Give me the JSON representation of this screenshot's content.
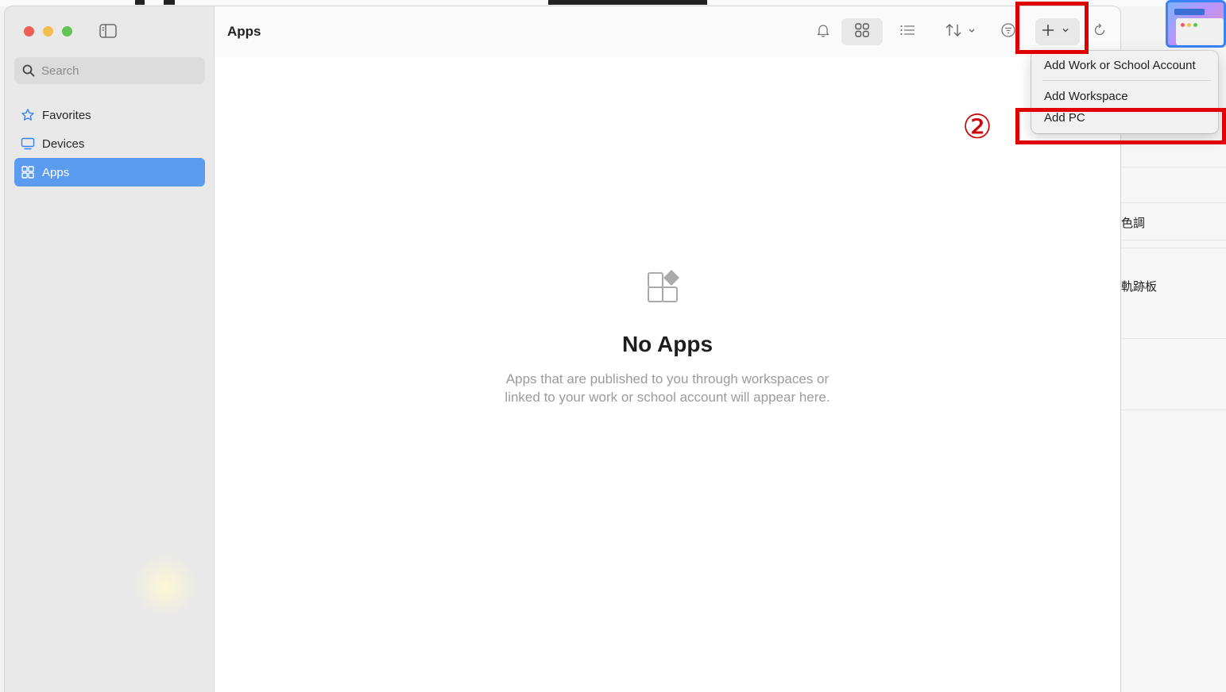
{
  "window": {
    "title": "Apps"
  },
  "search": {
    "placeholder": "Search"
  },
  "sidebar": {
    "items": [
      {
        "label": "Favorites",
        "icon": "star-icon"
      },
      {
        "label": "Devices",
        "icon": "monitor-icon"
      },
      {
        "label": "Apps",
        "icon": "apps-grid-icon",
        "selected": true
      }
    ]
  },
  "toolbar": {
    "buttons": [
      "bell-icon",
      "grid-view-icon",
      "list-view-icon",
      "sort-icon",
      "filter-icon",
      "add-icon",
      "refresh-icon"
    ],
    "selected_view": "grid-view-icon"
  },
  "empty_state": {
    "title": "No Apps",
    "message_line1": "Apps that are published to you through workspaces or",
    "message_line2": "linked to your work or school account will appear here."
  },
  "add_menu": {
    "items": [
      "Add Work or School Account",
      "Add Workspace",
      "Add PC"
    ]
  },
  "annotation": {
    "step_label": "②",
    "color": "#e00000"
  },
  "background_app": {
    "labels": [
      "色調",
      "軌跡板"
    ]
  },
  "colors": {
    "accent": "#5b9bf0",
    "close": "#ec5f57",
    "minimize": "#f4be4f",
    "zoom": "#61c454"
  }
}
